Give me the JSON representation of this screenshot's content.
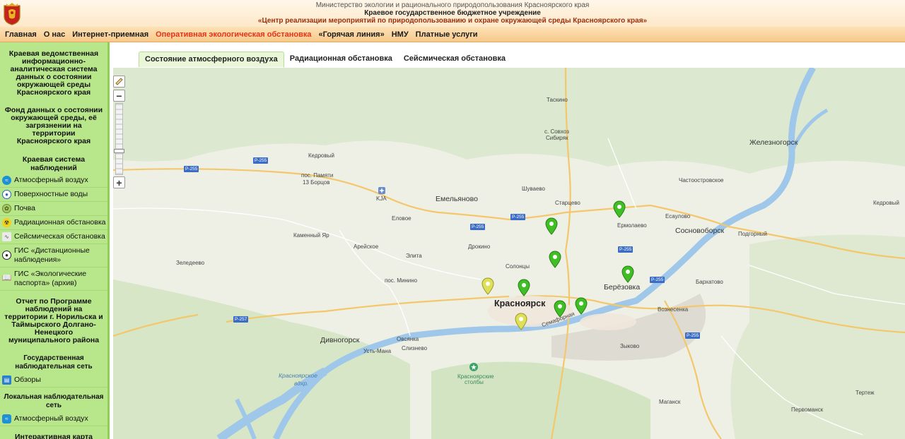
{
  "header": {
    "line1": "Министерство экологии и рационального природопользования Красноярского края",
    "line2": "Краевое государственное бюджетное учреждение",
    "line3": "«Центр реализации мероприятий по природопользованию и охране окружающей среды Красноярского края»"
  },
  "nav": [
    {
      "label": "Главная",
      "active": false
    },
    {
      "label": "О нас",
      "active": false
    },
    {
      "label": "Интернет-приемная",
      "active": false
    },
    {
      "label": "Оперативная экологическая обстановка",
      "active": true
    },
    {
      "label": "«Горячая линия»",
      "active": false
    },
    {
      "label": "НМУ",
      "active": false
    },
    {
      "label": "Платные услуги",
      "active": false
    }
  ],
  "sidebar": {
    "heading1": "Краевая ведомственная информационно-аналитическая система данных о состоянии окружающей среды Красноярского края",
    "heading2": "Фонд данных о состоянии окружающей среды, её загрязнении на территории Красноярского края",
    "section1": "Краевая система наблюдений",
    "items1": [
      {
        "label": "Атмосферный воздух",
        "icon": "air-icon"
      },
      {
        "label": "Поверхностные воды",
        "icon": "water-drop-icon"
      },
      {
        "label": "Почва",
        "icon": "soil-icon"
      },
      {
        "label": "Радиационная обстановка",
        "icon": "radiation-icon"
      },
      {
        "label": "Сейсмическая обстановка",
        "icon": "seismic-icon"
      },
      {
        "label": "ГИС «Дистанционные наблюдения»",
        "icon": "drop-icon"
      },
      {
        "label": "ГИС «Экологические паспорта» (архив)",
        "icon": "book-icon"
      }
    ],
    "heading3": "Отчет по Программе наблюдений на территории г. Норильска и Таймырского Долгано-Ненецкого муниципального района",
    "heading4": "Государственная наблюдательная сеть",
    "item_reviews": "Обзоры",
    "heading5": "Локальная наблюдательная сеть",
    "item_local_air": "Атмосферный воздух",
    "heading6": "Интерактивная карта контрольно-надзорных мероприятий"
  },
  "tabs": [
    {
      "label": "Состояние атмосферного воздуха",
      "active": true
    },
    {
      "label": "Радиационная обстановка",
      "active": false
    },
    {
      "label": "Сейсмическая обстановка",
      "active": false
    }
  ],
  "map": {
    "labels": {
      "taskino": "Таскино",
      "sovkhoz": "с. Совхоз",
      "sibiryak": "Сибиряк",
      "zheleznogorsk": "Железногорск",
      "kedrovy1": "Кедровый",
      "pamyati": "пос. Памяти",
      "borcov": "13 Борцов",
      "chastoostrovskoe": "Частоостровское",
      "kedrovy2": "Кедровый",
      "shuvaevo": "Шуваево",
      "emelyanovo": "Емельяново",
      "kja": "KJA",
      "startsevo": "Старцево",
      "esaulovo": "Есаулово",
      "elovoe": "Еловое",
      "ermolaevo": "Ермолаево",
      "sosnovoborsk": "Сосновоборск",
      "podgorny": "Подгорный",
      "kamenny_yar": "Каменный Яр",
      "areyskoe": "Арейское",
      "drokino": "Дрокино",
      "elita": "Элита",
      "zeledeevo": "Зеледеево",
      "solontsy": "Солонцы",
      "minino": "пос. Минино",
      "berezovka": "Берёзовка",
      "barkhatovo": "Бархатово",
      "krasnoyarsk": "Красноярск",
      "voznesenka": "Вознесенка",
      "semafornaya": "Семафорная",
      "divnogorsk": "Дивногорск",
      "ovsyanka": "Овсянка",
      "sliznevo": "Слизнево",
      "ust_mana": "Усть-Мана",
      "zykovo": "Зыково",
      "reservoir1": "Красноярское",
      "reservoir2": "вдхр.",
      "stolby1": "Красноярские",
      "stolby2": "столбы",
      "tertezh": "Тертеж",
      "magansk": "Маганск",
      "pervomansk": "Первоманск"
    },
    "route_r255": "Р-255",
    "route_r257": "Р-257",
    "zoom_in": "+",
    "zoom_out": "−",
    "markers_green": 8,
    "markers_yellow": 2
  }
}
